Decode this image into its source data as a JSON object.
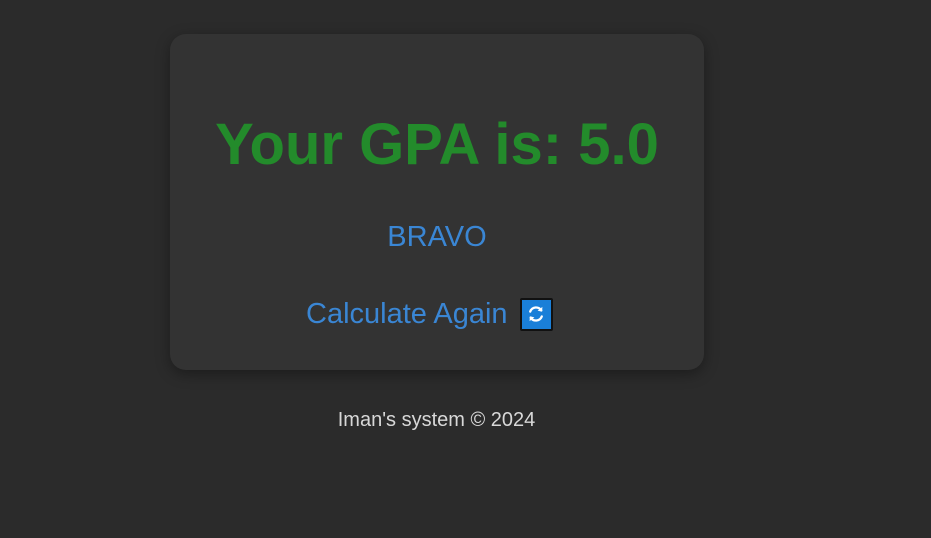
{
  "result": {
    "title": "Your GPA is: 5.0",
    "message": "BRAVO",
    "again_label": "Calculate Again",
    "again_icon": "refresh-icon"
  },
  "footer": {
    "text": "Iman's system © 2024"
  },
  "colors": {
    "background": "#2b2b2b",
    "card": "#333333",
    "gpa_green": "#238b2b",
    "link_blue": "#3a86d4",
    "icon_blue": "#1a7fd8",
    "footer_text": "#d8d8d8"
  }
}
